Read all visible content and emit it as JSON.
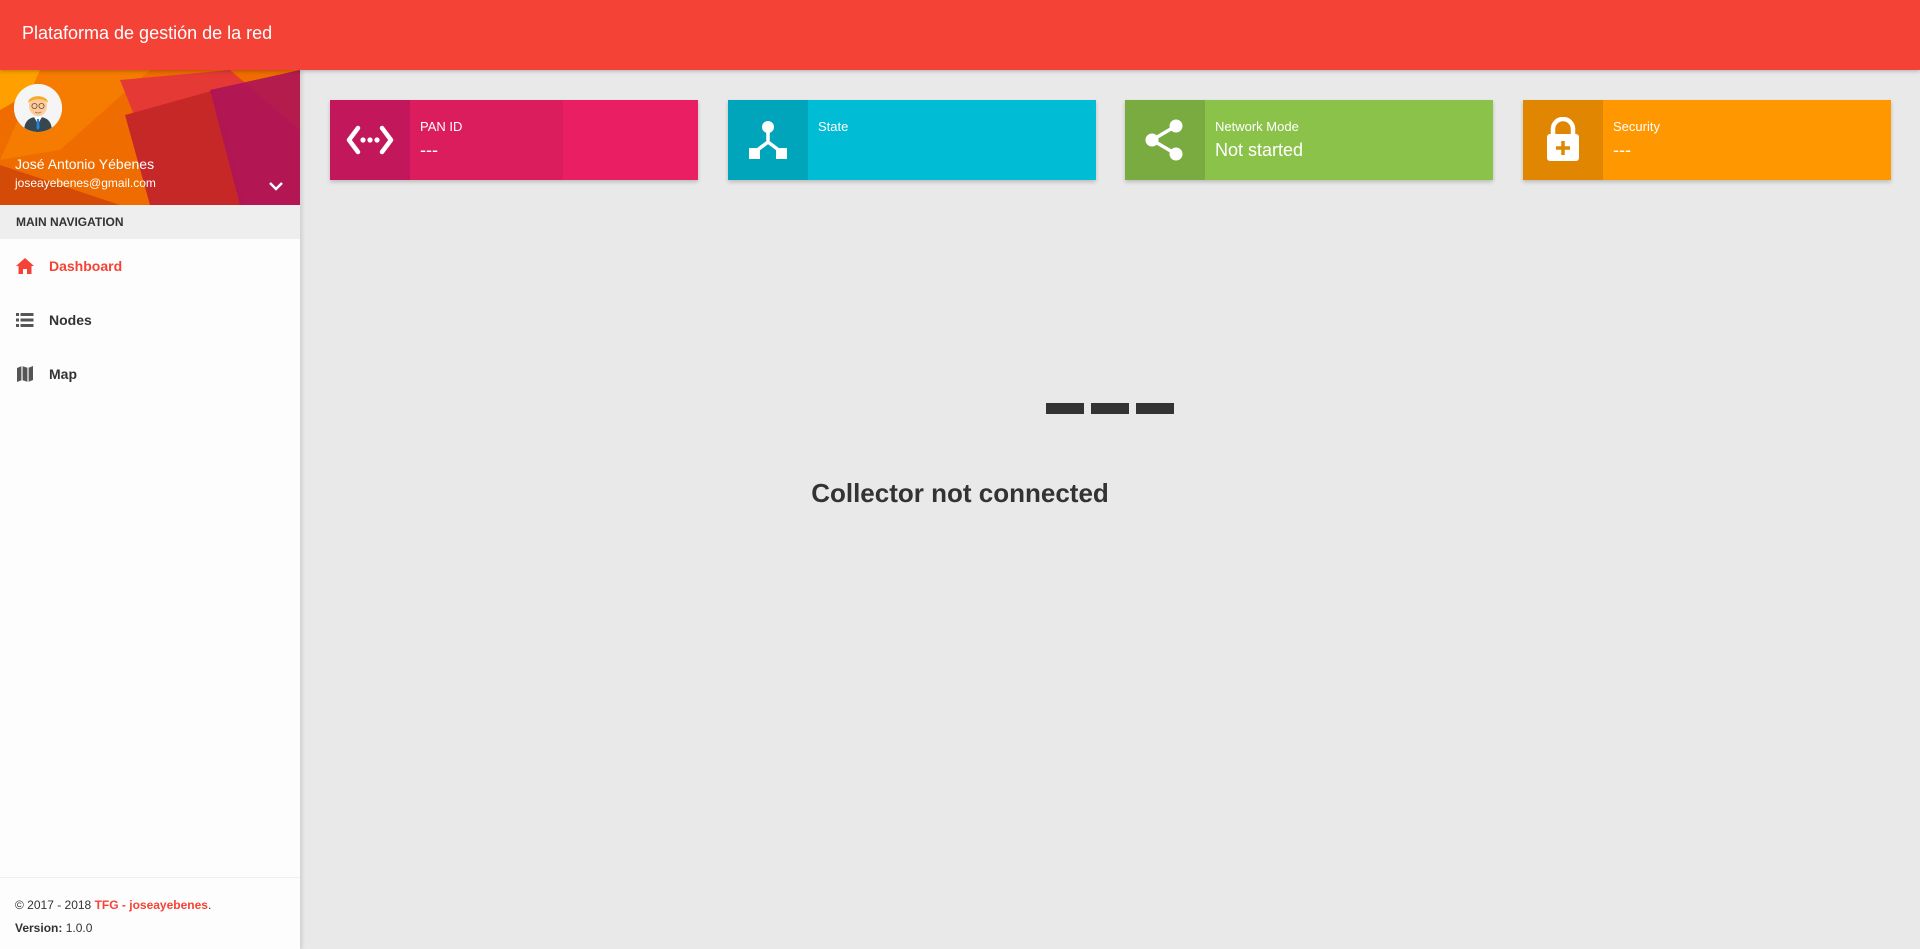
{
  "topbar": {
    "brand": "Plataforma de gestión de la red"
  },
  "user": {
    "name": "José Antonio Yébenes",
    "email": "joseayebenes@gmail.com"
  },
  "sidebar": {
    "header": "MAIN NAVIGATION",
    "items": [
      {
        "label": "Dashboard",
        "icon": "home-icon",
        "active": true
      },
      {
        "label": "Nodes",
        "icon": "list-icon",
        "active": false
      },
      {
        "label": "Map",
        "icon": "map-icon",
        "active": false
      }
    ]
  },
  "footer": {
    "copyright": "© 2017 - 2018 ",
    "link": "TFG - joseayebenes",
    "period": ".",
    "version_label": "Version:",
    "version": " 1.0.0"
  },
  "infoboxes": [
    {
      "label": "PAN ID",
      "value": "---",
      "color": "#e91e63",
      "icon": "code-arrows-icon"
    },
    {
      "label": "State",
      "value": "",
      "color": "#00bcd4",
      "icon": "device-hub-icon"
    },
    {
      "label": "Network Mode",
      "value": "Not started",
      "color": "#8bc34a",
      "icon": "share-icon"
    },
    {
      "label": "Security",
      "value": "---",
      "color": "#ff9800",
      "icon": "lock-add-icon"
    }
  ],
  "status": {
    "message": "Collector not connected"
  },
  "colors": {
    "primary": "#f44336",
    "background": "#e9e9e9"
  }
}
